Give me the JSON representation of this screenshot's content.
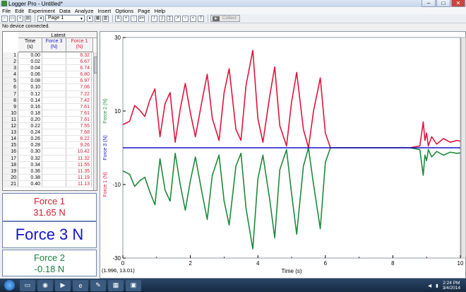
{
  "window": {
    "title": "Logger Pro - Untitled*",
    "minimize": "–",
    "maximize": "□",
    "close": "✕"
  },
  "menu": [
    "File",
    "Edit",
    "Experiment",
    "Data",
    "Analyze",
    "Insert",
    "Options",
    "Page",
    "Help"
  ],
  "toolbar": {
    "page_select": "Page 1",
    "collect_label": "Collect"
  },
  "status": "No device connected.",
  "table": {
    "dataset": "Latest",
    "columns": [
      {
        "name": "Time",
        "unit": "(s)"
      },
      {
        "name": "Force 3",
        "unit": "(N)"
      },
      {
        "name": "Force 1",
        "unit": "(N)"
      }
    ],
    "rows": [
      [
        "1",
        "0.00",
        "",
        "6.32"
      ],
      [
        "2",
        "0.02",
        "",
        "6.67"
      ],
      [
        "3",
        "0.04",
        "",
        "6.74"
      ],
      [
        "4",
        "0.06",
        "",
        "6.80"
      ],
      [
        "5",
        "0.08",
        "",
        "6.97"
      ],
      [
        "6",
        "0.10",
        "",
        "7.06"
      ],
      [
        "7",
        "0.12",
        "",
        "7.22"
      ],
      [
        "8",
        "0.14",
        "",
        "7.42"
      ],
      [
        "9",
        "0.16",
        "",
        "7.61"
      ],
      [
        "10",
        "0.18",
        "",
        "7.61"
      ],
      [
        "11",
        "0.20",
        "",
        "7.61"
      ],
      [
        "12",
        "0.22",
        "",
        "7.55"
      ],
      [
        "13",
        "0.24",
        "",
        "7.68"
      ],
      [
        "14",
        "0.26",
        "",
        "8.22"
      ],
      [
        "15",
        "0.28",
        "",
        "9.26"
      ],
      [
        "16",
        "0.30",
        "",
        "10.42"
      ],
      [
        "17",
        "0.32",
        "",
        "11.32"
      ],
      [
        "18",
        "0.34",
        "",
        "11.55"
      ],
      [
        "19",
        "0.36",
        "",
        "11.35"
      ],
      [
        "20",
        "0.38",
        "",
        "11.19"
      ],
      [
        "21",
        "0.40",
        "",
        "11.13"
      ]
    ]
  },
  "meters": {
    "force1": {
      "label": "Force 1",
      "value": "31.65 N"
    },
    "force3": {
      "label": "Force 3  N"
    },
    "force2": {
      "label": "Force 2",
      "value": "-0.18 N"
    }
  },
  "coord_readout": "(1.996, 13.01)",
  "taskbar": {
    "time": "2:24 PM",
    "date": "3/4/2014"
  },
  "chart_data": {
    "type": "line",
    "xlabel": "Time (s)",
    "ylabels": [
      "Force 1 (N)",
      "Force 3 (N)",
      "Force 2 (N)"
    ],
    "xlim": [
      0,
      10
    ],
    "ylim": [
      -30,
      30
    ],
    "xticks": [
      0,
      2,
      4,
      6,
      8,
      10
    ],
    "yticks": [
      -30,
      -10,
      10,
      30
    ],
    "colors": {
      "force1": "#e0143c",
      "force2": "#1e8a3c",
      "force3": "#1414c8",
      "axis_label_f2": "#1e8a3c"
    },
    "series": [
      {
        "name": "Force 1",
        "color": "#e0143c",
        "x": [
          0,
          0.2,
          0.35,
          0.5,
          0.65,
          0.8,
          0.95,
          1.1,
          1.25,
          1.4,
          1.55,
          1.7,
          1.85,
          2.0,
          2.15,
          2.35,
          2.5,
          2.65,
          2.85,
          3.0,
          3.15,
          3.35,
          3.5,
          3.65,
          3.85,
          4.0,
          4.15,
          4.35,
          4.5,
          4.65,
          4.85,
          5.0,
          5.15,
          5.35,
          5.5,
          5.65,
          5.85,
          6.0,
          6.15,
          6.3,
          6.5,
          7.0,
          7.5,
          8.0,
          8.5,
          8.8,
          8.9,
          8.95,
          9.0,
          9.05,
          9.15,
          9.3,
          9.5,
          9.7,
          9.9,
          10.0
        ],
        "y": [
          6.3,
          7.2,
          11.5,
          10.2,
          8.5,
          13.0,
          16.0,
          3.0,
          12.0,
          15.0,
          1.5,
          10.5,
          17.5,
          9.5,
          3.0,
          13.0,
          20.0,
          8.0,
          2.0,
          15.0,
          21.5,
          5.0,
          2.0,
          17.0,
          26.5,
          8.0,
          1.5,
          14.0,
          22.0,
          6.0,
          0.5,
          12.5,
          20.5,
          5.0,
          0.0,
          10.0,
          19.0,
          4.0,
          0.0,
          0.0,
          0.0,
          0.0,
          0.0,
          0.0,
          0.0,
          0.5,
          7.0,
          2.0,
          4.0,
          0.5,
          3.0,
          1.0,
          2.5,
          1.5,
          2.0,
          1.8
        ]
      },
      {
        "name": "Force 2",
        "color": "#1e8a3c",
        "x": [
          0,
          0.2,
          0.35,
          0.5,
          0.65,
          0.8,
          0.95,
          1.1,
          1.25,
          1.4,
          1.55,
          1.7,
          1.85,
          2.0,
          2.15,
          2.35,
          2.5,
          2.65,
          2.85,
          3.0,
          3.15,
          3.35,
          3.5,
          3.65,
          3.85,
          4.0,
          4.15,
          4.35,
          4.5,
          4.65,
          4.85,
          5.0,
          5.15,
          5.35,
          5.5,
          5.65,
          5.85,
          6.0,
          6.15,
          6.3,
          6.5,
          7.0,
          7.5,
          8.0,
          8.5,
          8.8,
          8.9,
          8.95,
          9.0,
          9.05,
          9.15,
          9.3,
          9.5,
          9.7,
          9.9,
          10.0
        ],
        "y": [
          -6.3,
          -7.2,
          -10.5,
          -9.0,
          -8.0,
          -12.0,
          -15.5,
          -3.0,
          -11.5,
          -14.5,
          -1.5,
          -10.0,
          -17.0,
          -9.0,
          -2.5,
          -12.5,
          -19.5,
          -7.5,
          -2.0,
          -14.5,
          -21.0,
          -5.0,
          -1.5,
          -16.5,
          -27.5,
          -8.5,
          -2.0,
          -14.0,
          -24.5,
          -6.0,
          -0.5,
          -12.5,
          -23.5,
          -5.0,
          0.0,
          -10.0,
          -22.0,
          -4.0,
          0.0,
          0.0,
          0.0,
          0.0,
          0.0,
          0.0,
          0.0,
          -0.5,
          -7.5,
          -2.0,
          -3.5,
          -0.5,
          -2.5,
          -1.0,
          -2.0,
          -1.2,
          -1.5,
          -1.4
        ]
      },
      {
        "name": "Force 3",
        "color": "#1414c8",
        "x": [
          0,
          10
        ],
        "y": [
          0,
          0
        ]
      }
    ]
  }
}
